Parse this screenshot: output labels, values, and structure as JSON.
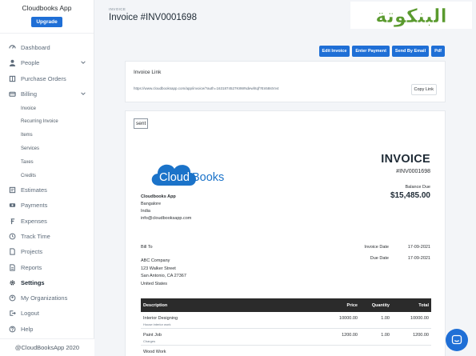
{
  "app": {
    "name": "Cloudbooks App",
    "upgrade_label": "Upgrade",
    "footer": "@CloudBooksApp 2020"
  },
  "nav": {
    "dashboard": "Dashboard",
    "people": "People",
    "purchase_orders": "Purchase Orders",
    "billing": "Billing",
    "billing_sub": [
      "Invoice",
      "Recurring Invoice",
      "Items",
      "Services",
      "Taxes",
      "Credits"
    ],
    "estimates": "Estimates",
    "payments": "Payments",
    "expenses": "Expenses",
    "track_time": "Track Time",
    "projects": "Projects",
    "reports": "Reports",
    "settings": "Settings",
    "my_organizations": "My Organizations",
    "logout": "Logout",
    "help": "Help"
  },
  "header": {
    "breadcrumb": "INVOICE",
    "title": "Invoice #INV0001698"
  },
  "actions": {
    "edit": "Edit Invoice",
    "enter_payment": "Enter Payment",
    "send_email": "Send By Email",
    "pdf": "Pdf"
  },
  "invoice_link": {
    "title": "Invoice Link",
    "url": "https://www.cloudbooksapp.com/app/invoice/?auth=1631874527K8WNdewhtqf?En58stVv4",
    "copy_label": "Copy Link"
  },
  "invoice": {
    "status": "sent",
    "logo_text": "CloudBooks",
    "heading": "INVOICE",
    "number": "#INV0001698",
    "balance_label": "Balance Due",
    "balance": "$15,485.00",
    "from": {
      "name": "Cloudbooks App",
      "city": "Bangalore",
      "country": "India",
      "email": "info@cloudbooksapp.com"
    },
    "bill_to_label": "Bill To",
    "bill_to": {
      "company": "ABC Company",
      "street": "123 Walker Street",
      "city": "San Antonio, CA 27367",
      "country": "United States"
    },
    "invoice_date_label": "Invoice Date",
    "invoice_date": "17-09-2021",
    "due_date_label": "Due Date",
    "due_date": "17-09-2021"
  },
  "table": {
    "headers": {
      "description": "Description",
      "price": "Price",
      "quantity": "Quantity",
      "total": "Total"
    },
    "rows": [
      {
        "description": "Interior Designing",
        "detail": "House interior work",
        "price": "10000.00",
        "qty": "1.00",
        "total": "10000.00"
      },
      {
        "description": "Paint Job",
        "detail": "Charges",
        "price": "1200.00",
        "qty": "1.00",
        "total": "1200.00"
      },
      {
        "description": "Wood Work",
        "detail": "",
        "price": "",
        "qty": "",
        "total": ""
      }
    ]
  },
  "watermark": {
    "text": "البنكوتة"
  },
  "colors": {
    "primary": "#1f6fd6",
    "table_header": "#2b2b2b",
    "logo_blue": "#1b73c9",
    "watermark_green": "#5a9a2e"
  }
}
